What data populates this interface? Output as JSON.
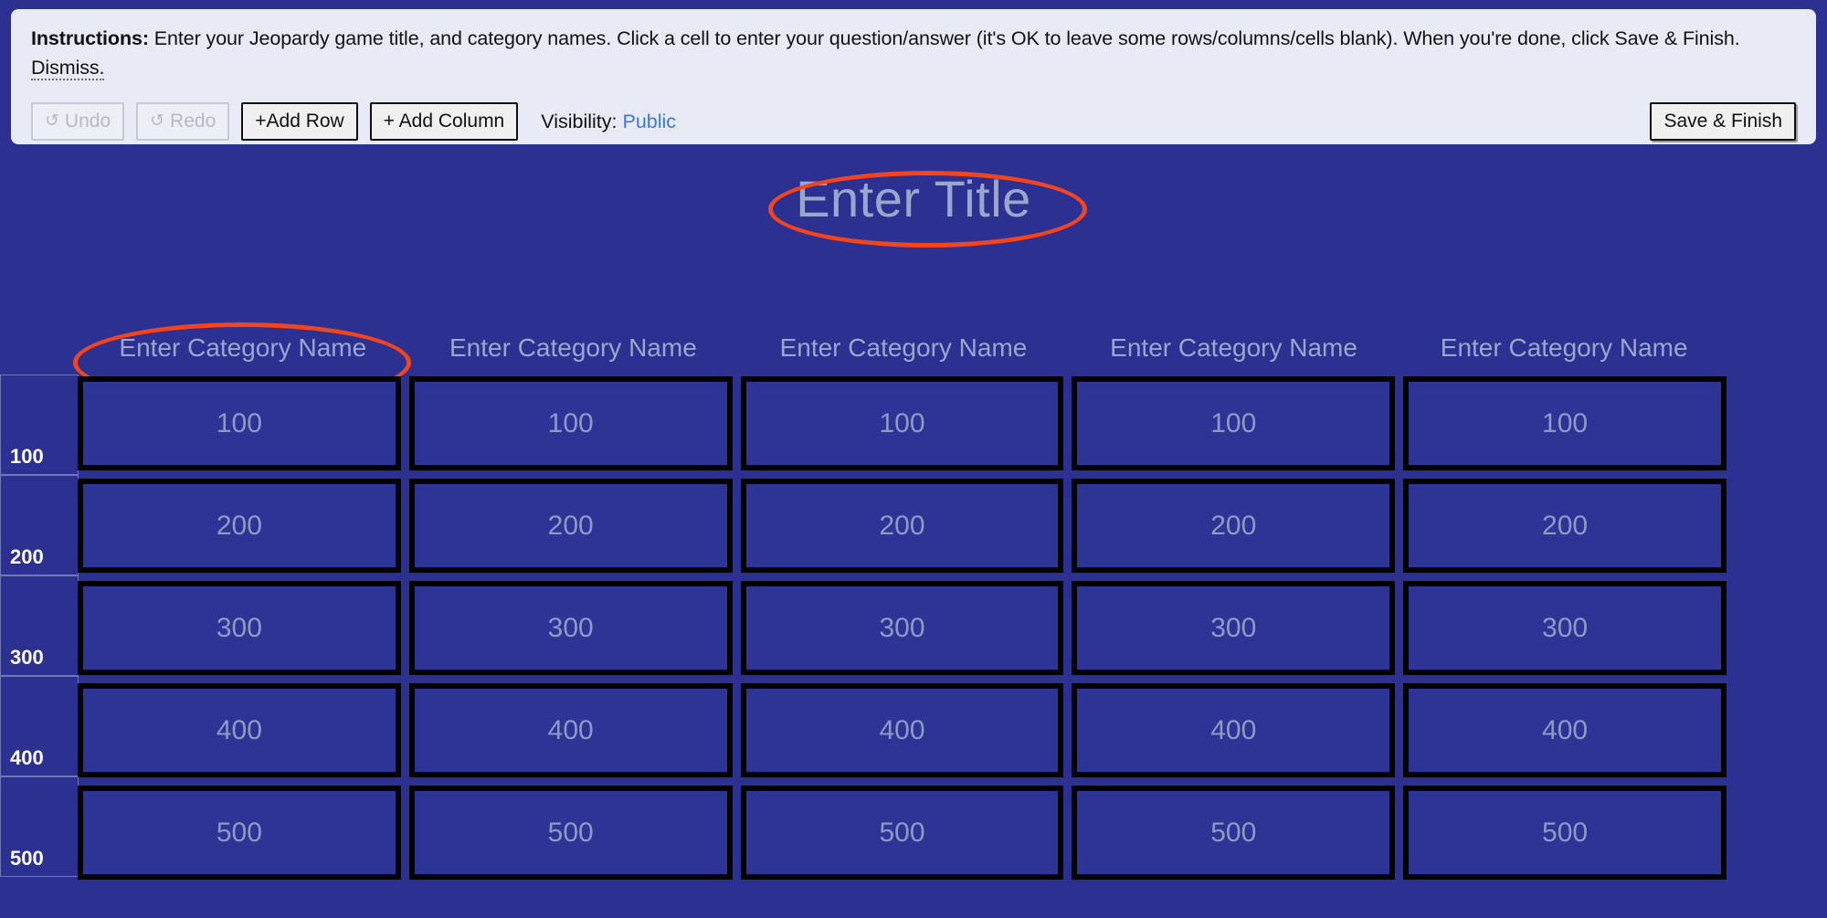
{
  "page": {
    "background_color": "#2c3191",
    "accent_color": "#f4441e",
    "link_color": "#3b78e7"
  },
  "instructions": {
    "lead": "Instructions:",
    "body": " Enter your Jeopardy game title, and category names. Click a cell to enter your question/answer (it's OK to leave some rows/columns/cells blank). When you're done, click Save & Finish. ",
    "dismiss_label": "Dismiss."
  },
  "toolbar": {
    "undo_label": "Undo",
    "undo_icon": "undo-arrow-icon",
    "undo_icon_glyph": "↺",
    "redo_label": "Redo",
    "redo_icon": "redo-arrow-icon",
    "redo_icon_glyph": "↺",
    "add_row_label": "+Add Row",
    "add_column_label": "+ Add Column",
    "visibility_label": "Visibility:",
    "visibility_value": "Public",
    "save_finish_label": "Save & Finish"
  },
  "board": {
    "title_placeholder": "Enter Title",
    "category_placeholder": "Enter Category Name",
    "categories": [
      "Enter Category Name",
      "Enter Category Name",
      "Enter Category Name",
      "Enter Category Name",
      "Enter Category Name"
    ],
    "row_values": [
      "100",
      "200",
      "300",
      "400",
      "500"
    ],
    "rows": [
      {
        "value": "100",
        "cells": [
          "100",
          "100",
          "100",
          "100",
          "100"
        ]
      },
      {
        "value": "200",
        "cells": [
          "200",
          "200",
          "200",
          "200",
          "200"
        ]
      },
      {
        "value": "300",
        "cells": [
          "300",
          "300",
          "300",
          "300",
          "300"
        ]
      },
      {
        "value": "400",
        "cells": [
          "400",
          "400",
          "400",
          "400",
          "400"
        ]
      },
      {
        "value": "500",
        "cells": [
          "500",
          "500",
          "500",
          "500",
          "500"
        ]
      }
    ]
  },
  "annotations": [
    {
      "name": "title-annotation",
      "shape": "ellipse",
      "color": "#f4441e",
      "targets": "board title"
    },
    {
      "name": "category-annotation",
      "shape": "ellipse",
      "color": "#f4441e",
      "targets": "first category name"
    }
  ]
}
